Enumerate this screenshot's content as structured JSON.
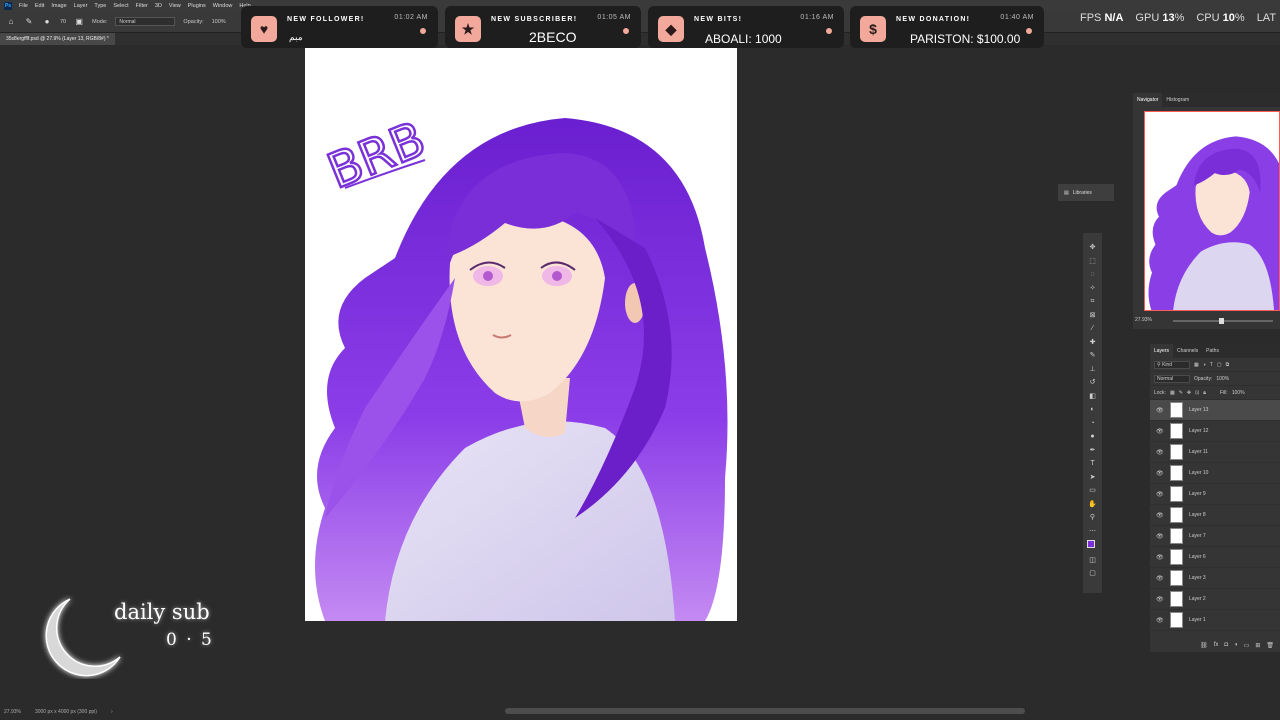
{
  "menubar": {
    "logo": "Ps",
    "items": [
      "File",
      "Edit",
      "Image",
      "Layer",
      "Type",
      "Select",
      "Filter",
      "3D",
      "View",
      "Plugins",
      "Window",
      "Help"
    ]
  },
  "options": {
    "brush_size": "70",
    "mode_label": "Mode:",
    "mode_value": "Normal",
    "opacity_label": "Opacity:",
    "opacity_value": "100%"
  },
  "document": {
    "tab_title": "35s8ergfflf.psd @ 27.9% (Layer 13, RGB/8#) *",
    "artwork_text": "BRB"
  },
  "alerts": [
    {
      "title": "NEW FOLLOWER!",
      "time": "01:02 AM",
      "name": "مبم",
      "icon": "heart-icon"
    },
    {
      "title": "NEW SUBSCRIBER!",
      "time": "01:05 AM",
      "name": "2BECO",
      "icon": "star-icon"
    },
    {
      "title": "NEW BITS!",
      "time": "01:16 AM",
      "name": "ABOALI: 1000",
      "icon": "diamond-icon"
    },
    {
      "title": "NEW DONATION!",
      "time": "01:40 AM",
      "name": "PARISTON: $100.00",
      "icon": "dollar-icon"
    }
  ],
  "stats": {
    "fps_label": "FPS",
    "fps_value": "N/A",
    "gpu_label": "GPU",
    "gpu_value": "13",
    "cpu_label": "CPU",
    "cpu_value": "10",
    "percent": "%",
    "lat_label": "LAT"
  },
  "navigator": {
    "tab_navigator": "Navigator",
    "tab_histogram": "Histogram",
    "zoom": "27.93%"
  },
  "libraries": {
    "label": "Libraries"
  },
  "layers": {
    "tabs": [
      "Layers",
      "Channels",
      "Paths"
    ],
    "filter_kind": "Kind",
    "blend_mode": "Normal",
    "opacity_label": "Opacity:",
    "opacity_value": "100%",
    "lock_label": "Lock:",
    "fill_label": "Fill:",
    "fill_value": "100%",
    "items": [
      "Layer 13",
      "Layer 12",
      "Layer 11",
      "Layer 10",
      "Layer 9",
      "Layer 8",
      "Layer 7",
      "Layer 6",
      "Layer 3",
      "Layer 2",
      "Layer 1"
    ],
    "selected_index": 0
  },
  "overlay": {
    "daily_sub_label": "daily sub",
    "daily_sub_count": "0 · 5"
  },
  "statusbar": {
    "zoom": "27.93%",
    "doc_size": "3000 px x 4000 px (300 ppi)"
  },
  "colors": {
    "accent_alert": "#f2a99b",
    "foreground_color": "#7a2fd6",
    "navigator_border": "#ff5a5a"
  }
}
